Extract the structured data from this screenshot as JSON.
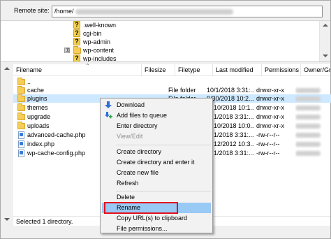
{
  "remote_site": {
    "label": "Remote site:",
    "path": "/home/"
  },
  "tree": {
    "items": [
      {
        "label": ".well-known",
        "icon": "question-folder-icon"
      },
      {
        "label": "cgi-bin",
        "icon": "question-folder-icon"
      },
      {
        "label": "wp-admin",
        "icon": "question-folder-icon"
      },
      {
        "label": "wp-content",
        "icon": "folder-icon",
        "expander": "⊞"
      },
      {
        "label": "wp-includes",
        "icon": "question-folder-icon"
      }
    ]
  },
  "columns": {
    "filename": "Filename",
    "filesize": "Filesize",
    "filetype": "Filetype",
    "last_modified": "Last modified",
    "permissions": "Permissions",
    "owner_group": "Owner/Gro"
  },
  "files": [
    {
      "name": "..",
      "filesize": "",
      "filetype": "",
      "modified": "",
      "perms": "",
      "kind": "folder"
    },
    {
      "name": "cache",
      "filesize": "",
      "filetype": "File folder",
      "modified": "10/1/2018 3:31:...",
      "perms": "drwxr-xr-x",
      "kind": "folder"
    },
    {
      "name": "plugins",
      "filesize": "",
      "filetype": "File folder",
      "modified": "9/30/2018 10:2...",
      "perms": "drwxr-xr-x",
      "kind": "folder",
      "selected": true
    },
    {
      "name": "themes",
      "filesize": "",
      "filetype": "",
      "modified": "10/2018 10:1...",
      "perms": "drwxr-xr-x",
      "kind": "folder"
    },
    {
      "name": "upgrade",
      "filesize": "",
      "filetype": "",
      "modified": "1/2018 3:31:...",
      "perms": "drwxr-xr-x",
      "kind": "folder"
    },
    {
      "name": "uploads",
      "filesize": "",
      "filetype": "",
      "modified": "10/2018 10:0...",
      "perms": "drwxr-xr-x",
      "kind": "folder"
    },
    {
      "name": "advanced-cache.php",
      "filesize": "",
      "filetype": "",
      "modified": "1/2018 3:31:...",
      "perms": "-rw-r--r--",
      "kind": "file"
    },
    {
      "name": "index.php",
      "filesize": "",
      "filetype": "",
      "modified": "12/2012 10:3...",
      "perms": "-rw-r--r--",
      "kind": "file"
    },
    {
      "name": "wp-cache-config.php",
      "filesize": "",
      "filetype": "",
      "modified": "1/2018 3:31:...",
      "perms": "-rw-r--r--",
      "kind": "file"
    }
  ],
  "status": "Selected 1 directory.",
  "context_menu": {
    "items": [
      {
        "label": "Download",
        "icon": "download-arrow-icon"
      },
      {
        "label": "Add files to queue",
        "icon": "add-queue-icon"
      },
      {
        "label": "Enter directory"
      },
      {
        "label": "View/Edit",
        "disabled": true
      },
      {
        "separator": true
      },
      {
        "label": "Create directory"
      },
      {
        "label": "Create directory and enter it"
      },
      {
        "label": "Create new file"
      },
      {
        "label": "Refresh"
      },
      {
        "separator": true
      },
      {
        "label": "Delete"
      },
      {
        "label": "Rename",
        "highlighted": true
      },
      {
        "label": "Copy URL(s) to clipboard"
      },
      {
        "label": "File permissions..."
      }
    ]
  },
  "colors": {
    "selection": "#cde8ff",
    "menu_highlight": "#99c9f5",
    "rename_outline": "#e3101a",
    "folder": "#f5cd57"
  }
}
